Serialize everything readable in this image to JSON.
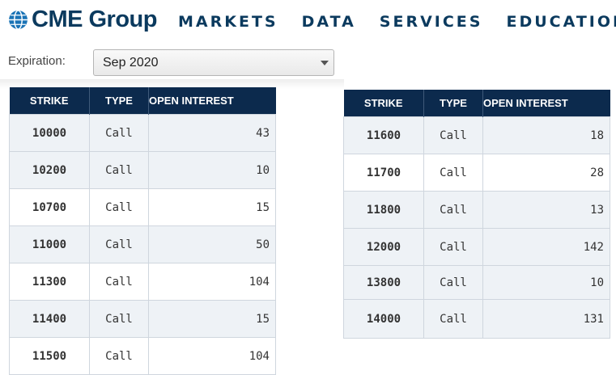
{
  "header": {
    "logo_text": "CME Group",
    "nav": [
      "MARKETS",
      "DATA",
      "SERVICES",
      "EDUCATION"
    ]
  },
  "filter": {
    "label": "Expiration:",
    "selected": "Sep 2020"
  },
  "columns": {
    "strike": "STRIKE",
    "type": "TYPE",
    "oi": "OPEN INTEREST"
  },
  "left_table": [
    {
      "strike": "10000",
      "type": "Call",
      "oi": "43"
    },
    {
      "strike": "10200",
      "type": "Call",
      "oi": "10"
    },
    {
      "strike": "10700",
      "type": "Call",
      "oi": "15"
    },
    {
      "strike": "11000",
      "type": "Call",
      "oi": "50"
    },
    {
      "strike": "11300",
      "type": "Call",
      "oi": "104"
    },
    {
      "strike": "11400",
      "type": "Call",
      "oi": "15"
    },
    {
      "strike": "11500",
      "type": "Call",
      "oi": "104"
    }
  ],
  "right_table": [
    {
      "strike": "11600",
      "type": "Call",
      "oi": "18"
    },
    {
      "strike": "11700",
      "type": "Call",
      "oi": "28"
    },
    {
      "strike": "11800",
      "type": "Call",
      "oi": "13"
    },
    {
      "strike": "12000",
      "type": "Call",
      "oi": "142"
    },
    {
      "strike": "13800",
      "type": "Call",
      "oi": "10"
    },
    {
      "strike": "14000",
      "type": "Call",
      "oi": "131"
    }
  ],
  "colors": {
    "header_bg": "#0c2a4d",
    "brand": "#0b3a5e",
    "row_shade": "#eef2f6"
  }
}
